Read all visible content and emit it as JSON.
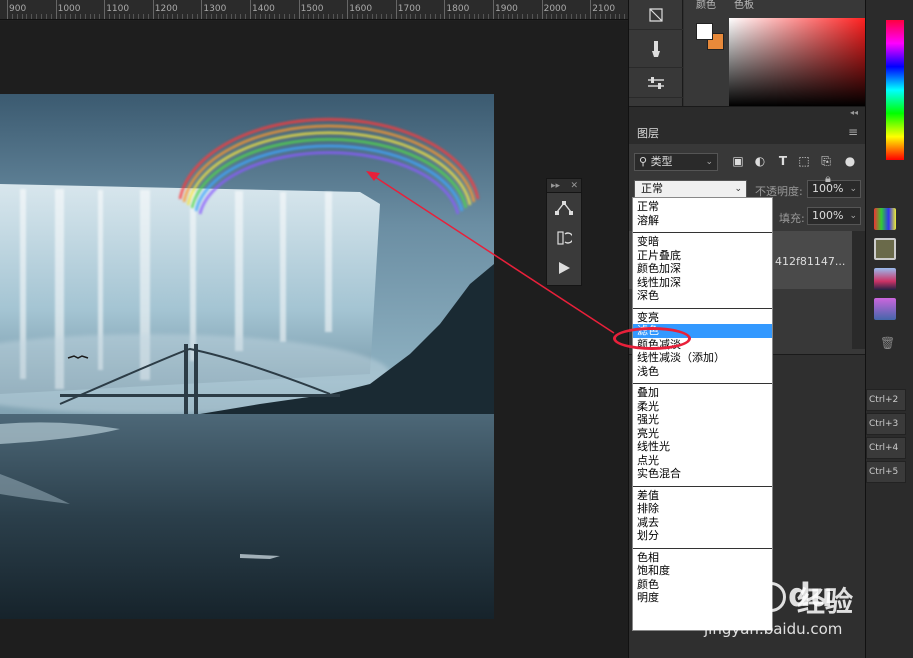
{
  "ruler": {
    "labels": [
      "900",
      "1000",
      "1100",
      "1200",
      "1300",
      "1400",
      "1500",
      "1600",
      "1700",
      "1800",
      "1900",
      "2000",
      "2100"
    ]
  },
  "color_panel": {
    "tab_color": "颜色",
    "tab_swatches": "色板",
    "foreground": "#ffffff",
    "background": "#e8893a"
  },
  "layers_panel": {
    "tab_label": "图层",
    "kind_filter": "类型",
    "blend_mode_value": "正常",
    "opacity_label": "不透明度:",
    "opacity_value": "100%",
    "fill_label": "填充:",
    "fill_value": "100%",
    "layer_name": "412f81147..."
  },
  "blend_modes": {
    "groups": [
      [
        "正常",
        "溶解"
      ],
      [
        "变暗",
        "正片叠底",
        "颜色加深",
        "线性加深",
        "深色"
      ],
      [
        "变亮",
        "滤色",
        "颜色减淡",
        "线性减淡（添加）",
        "浅色"
      ],
      [
        "叠加",
        "柔光",
        "强光",
        "亮光",
        "线性光",
        "点光",
        "实色混合"
      ],
      [
        "差值",
        "排除",
        "减去",
        "划分"
      ],
      [
        "色相",
        "饱和度",
        "颜色",
        "明度"
      ]
    ],
    "selected": "滤色"
  },
  "shortcuts": [
    "Ctrl+2",
    "Ctrl+3",
    "Ctrl+4",
    "Ctrl+5"
  ],
  "icons": {
    "float_tools": [
      "pen-path-icon",
      "history-brush-icon",
      "play-icon"
    ],
    "filters": [
      "image-filter-icon",
      "adjustment-filter-icon",
      "type-filter-icon",
      "shape-filter-icon",
      "smart-object-filter-icon"
    ]
  },
  "accent_color": "#e8203a",
  "selection_color": "#3399ff"
}
